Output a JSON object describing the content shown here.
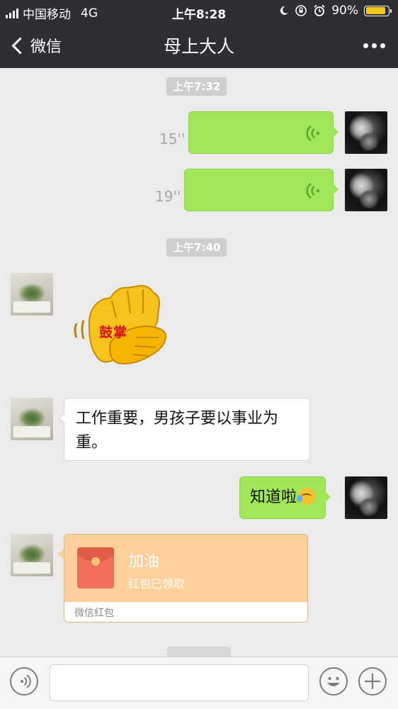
{
  "status_bar": {
    "carrier": "中国移动",
    "network": "4G",
    "time": "上午8:28",
    "battery": "90%",
    "battery_level": 0.9
  },
  "nav": {
    "back_label": "微信",
    "title": "母上大人",
    "more_icon": "more-icon"
  },
  "messages": {
    "time1": "上午7:32",
    "voice1_duration": "15''",
    "voice2_duration": "19''",
    "time2": "上午7:40",
    "sticker_text": "鼓掌",
    "text1": "工作重要，男孩子要以事业为重。",
    "text2": "知道啦",
    "red_packet": {
      "title": "加油",
      "status": "红包已领取",
      "footer": "微信红包"
    }
  },
  "input_bar": {
    "voice_icon": "voice-input-icon",
    "emoji_icon": "emoji-icon",
    "plus_icon": "plus-icon",
    "text_value": ""
  },
  "colors": {
    "nav_bg": "#2e2e33",
    "chat_bg": "#ebebeb",
    "my_bubble": "#9fe658",
    "red_packet": "#fdcf9b"
  }
}
